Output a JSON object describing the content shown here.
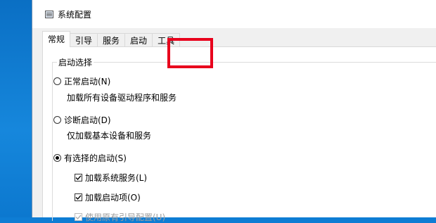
{
  "window": {
    "title": "系统配置",
    "icon": "msconfig-icon"
  },
  "tabs": [
    {
      "label": "常规",
      "active": true
    },
    {
      "label": "引导",
      "active": false
    },
    {
      "label": "服务",
      "active": false
    },
    {
      "label": "启动",
      "active": false
    },
    {
      "label": "工具",
      "active": false,
      "highlighted": true
    }
  ],
  "startup_selection": {
    "group_title": "启动选择",
    "options": [
      {
        "label": "正常启动(N)",
        "description": "加载所有设备驱动程序和服务",
        "selected": false
      },
      {
        "label": "诊断启动(D)",
        "description": "仅加载基本设备和服务",
        "selected": false
      },
      {
        "label": "有选择的启动(S)",
        "selected": true
      }
    ],
    "selective_items": [
      {
        "label": "加载系统服务(L)",
        "checked": true,
        "enabled": true
      },
      {
        "label": "加载启动项(O)",
        "checked": true,
        "enabled": true
      },
      {
        "label": "使用原有引导配置(U)",
        "checked": true,
        "enabled": false
      }
    ]
  },
  "colors": {
    "highlight": "#e8001c",
    "desktop": "#0e7dd4"
  }
}
